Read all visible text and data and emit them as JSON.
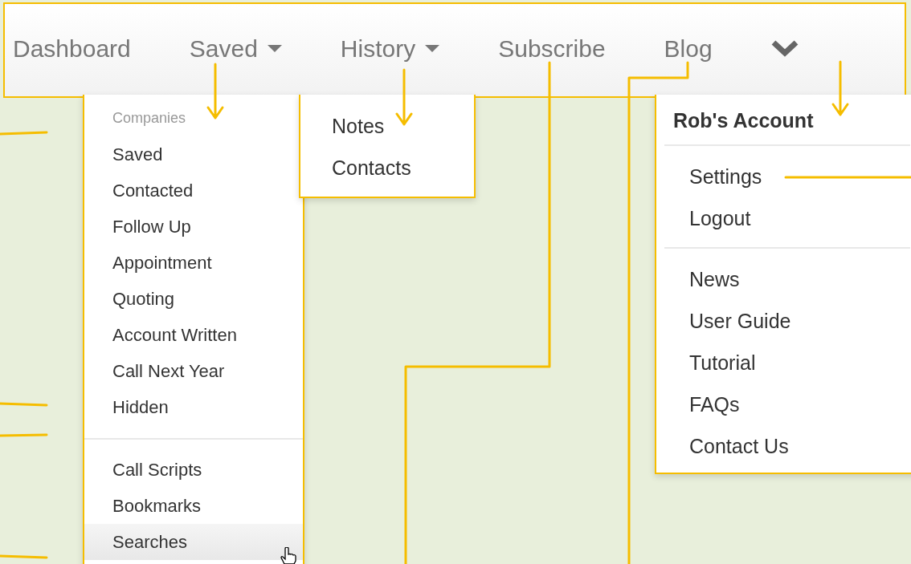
{
  "nav": {
    "items": [
      {
        "label": "Dashboard",
        "kind": "link"
      },
      {
        "label": "Saved",
        "kind": "dropdown"
      },
      {
        "label": "History",
        "kind": "dropdown"
      },
      {
        "label": "Subscribe",
        "kind": "link"
      },
      {
        "label": "Blog",
        "kind": "link"
      },
      {
        "kind": "chevron"
      }
    ]
  },
  "saved_menu": {
    "sections": [
      {
        "header": "Companies",
        "items": [
          {
            "label": "Saved",
            "selected": false
          },
          {
            "label": "Contacted",
            "selected": false
          },
          {
            "label": "Follow Up",
            "selected": false
          },
          {
            "label": "Appointment",
            "selected": false
          },
          {
            "label": "Quoting",
            "selected": false
          },
          {
            "label": "Account Written",
            "selected": false
          },
          {
            "label": "Call Next Year",
            "selected": false
          },
          {
            "label": "Hidden",
            "selected": false
          }
        ]
      },
      {
        "items": [
          {
            "label": "Call Scripts",
            "selected": false
          },
          {
            "label": "Bookmarks",
            "selected": false
          },
          {
            "label": "Searches",
            "selected": true
          }
        ]
      }
    ]
  },
  "history_menu": {
    "items": [
      "Notes",
      "Contacts"
    ]
  },
  "account_menu": {
    "header": "Rob's Account",
    "sections": [
      {
        "items": [
          "Settings",
          "Logout"
        ]
      },
      {
        "items": [
          "News",
          "User Guide",
          "Tutorial",
          "FAQs",
          "Contact Us"
        ]
      }
    ]
  }
}
